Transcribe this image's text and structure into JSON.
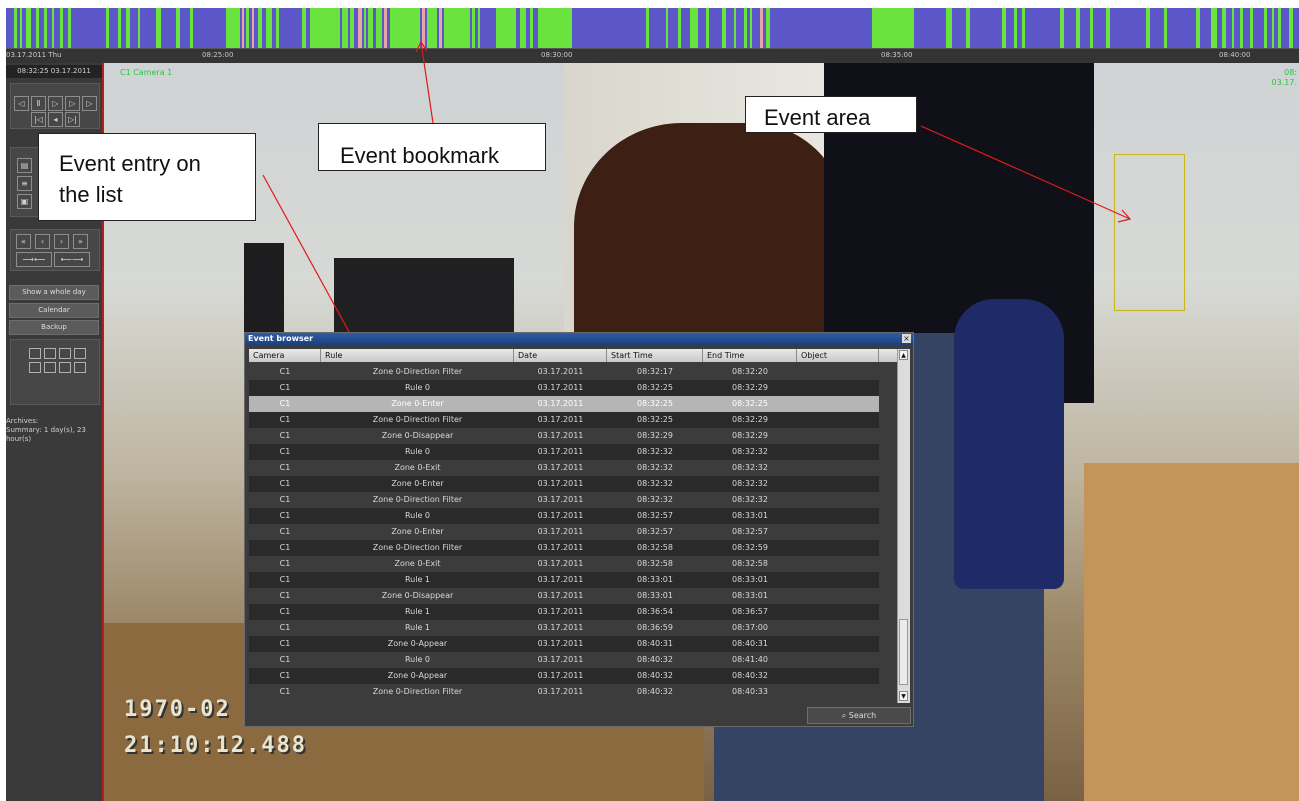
{
  "timeline": {
    "date_label": "03.17.2011 Thu",
    "ticks": [
      "08:25:00",
      "08:30:00",
      "08:35:00",
      "08:40:00"
    ],
    "colors": {
      "base": "#5b57c9",
      "event": "#6be33f",
      "bookmark": "#e7a6a6"
    }
  },
  "left_panel": {
    "datetime": "08:32:25 03.17.2011",
    "playback_icons": [
      "step-back-icon",
      "pause-icon",
      "play-icon",
      "step-forward-icon",
      "fast-forward-icon"
    ],
    "frame_icons": [
      "skip-start-icon",
      "play-reverse-icon",
      "skip-end-icon"
    ],
    "nav_icons": [
      "fast-rewind-icon",
      "rewind-icon",
      "forward-icon",
      "fast-forward-icon"
    ],
    "buttons": {
      "show_whole_day": "Show a whole day",
      "calendar": "Calendar",
      "backup": "Backup"
    },
    "archives_text": "Archives:\nSummary: 1 day(s), 23\nhour(s)"
  },
  "video": {
    "camera_label": "C1 Camera 1",
    "time_overlay": "08:\n03.17.",
    "osd_date": "1970-02",
    "osd_time": "21:10:12.488"
  },
  "callouts": {
    "event_entry": "Event entry on\nthe list",
    "event_bookmark": "Event bookmark",
    "event_area": "Event area"
  },
  "event_browser": {
    "title": "Event browser",
    "close_label": "×",
    "columns": [
      "Camera",
      "Rule",
      "Date",
      "Start Time",
      "End Time",
      "Object"
    ],
    "selected_row": 2,
    "rows": [
      {
        "camera": "C1",
        "rule": "Zone 0-Direction Filter",
        "date": "03.17.2011",
        "start": "08:32:17",
        "end": "08:32:20"
      },
      {
        "camera": "C1",
        "rule": "Rule 0",
        "date": "03.17.2011",
        "start": "08:32:25",
        "end": "08:32:29"
      },
      {
        "camera": "C1",
        "rule": "Zone 0-Enter",
        "date": "03.17.2011",
        "start": "08:32:25",
        "end": "08:32:25"
      },
      {
        "camera": "C1",
        "rule": "Zone 0-Direction Filter",
        "date": "03.17.2011",
        "start": "08:32:25",
        "end": "08:32:29"
      },
      {
        "camera": "C1",
        "rule": "Zone 0-Disappear",
        "date": "03.17.2011",
        "start": "08:32:29",
        "end": "08:32:29"
      },
      {
        "camera": "C1",
        "rule": "Rule 0",
        "date": "03.17.2011",
        "start": "08:32:32",
        "end": "08:32:32"
      },
      {
        "camera": "C1",
        "rule": "Zone 0-Exit",
        "date": "03.17.2011",
        "start": "08:32:32",
        "end": "08:32:32"
      },
      {
        "camera": "C1",
        "rule": "Zone 0-Enter",
        "date": "03.17.2011",
        "start": "08:32:32",
        "end": "08:32:32"
      },
      {
        "camera": "C1",
        "rule": "Zone 0-Direction Filter",
        "date": "03.17.2011",
        "start": "08:32:32",
        "end": "08:32:32"
      },
      {
        "camera": "C1",
        "rule": "Rule 0",
        "date": "03.17.2011",
        "start": "08:32:57",
        "end": "08:33:01"
      },
      {
        "camera": "C1",
        "rule": "Zone 0-Enter",
        "date": "03.17.2011",
        "start": "08:32:57",
        "end": "08:32:57"
      },
      {
        "camera": "C1",
        "rule": "Zone 0-Direction Filter",
        "date": "03.17.2011",
        "start": "08:32:58",
        "end": "08:32:59"
      },
      {
        "camera": "C1",
        "rule": "Zone 0-Exit",
        "date": "03.17.2011",
        "start": "08:32:58",
        "end": "08:32:58"
      },
      {
        "camera": "C1",
        "rule": "Rule 1",
        "date": "03.17.2011",
        "start": "08:33:01",
        "end": "08:33:01"
      },
      {
        "camera": "C1",
        "rule": "Zone 0-Disappear",
        "date": "03.17.2011",
        "start": "08:33:01",
        "end": "08:33:01"
      },
      {
        "camera": "C1",
        "rule": "Rule 1",
        "date": "03.17.2011",
        "start": "08:36:54",
        "end": "08:36:57"
      },
      {
        "camera": "C1",
        "rule": "Rule 1",
        "date": "03.17.2011",
        "start": "08:36:59",
        "end": "08:37:00"
      },
      {
        "camera": "C1",
        "rule": "Zone 0-Appear",
        "date": "03.17.2011",
        "start": "08:40:31",
        "end": "08:40:31"
      },
      {
        "camera": "C1",
        "rule": "Rule 0",
        "date": "03.17.2011",
        "start": "08:40:32",
        "end": "08:41:40"
      },
      {
        "camera": "C1",
        "rule": "Zone 0-Appear",
        "date": "03.17.2011",
        "start": "08:40:32",
        "end": "08:40:32"
      },
      {
        "camera": "C1",
        "rule": "Zone 0-Direction Filter",
        "date": "03.17.2011",
        "start": "08:40:32",
        "end": "08:40:33"
      }
    ],
    "search_label": "Search",
    "search_icon": "magnifier-icon"
  }
}
